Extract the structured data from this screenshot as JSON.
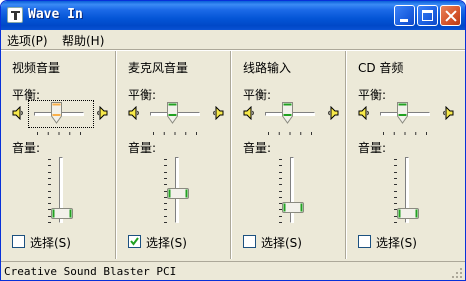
{
  "window": {
    "title": "Wave In"
  },
  "menu": [
    {
      "label": "选项(P)"
    },
    {
      "label": "帮助(H)"
    }
  ],
  "labels": {
    "balance": "平衡:",
    "volume": "音量:",
    "select": "选择(S)"
  },
  "channels": [
    {
      "name": "视频音量",
      "balance_level": 0.5,
      "volume_level": 0.12,
      "selected": false,
      "focused": true
    },
    {
      "name": "麦克风音量",
      "balance_level": 0.5,
      "volume_level": 0.45,
      "selected": true,
      "focused": false
    },
    {
      "name": "线路输入",
      "balance_level": 0.5,
      "volume_level": 0.22,
      "selected": false,
      "focused": false
    },
    {
      "name": "CD 音频",
      "balance_level": 0.5,
      "volume_level": 0.12,
      "selected": false,
      "focused": false
    }
  ],
  "status": {
    "text": "Creative Sound Blaster PCI"
  },
  "colors": {
    "title_bar": "#0455d6",
    "face": "#ece9d8",
    "thumb_green": "#21a121"
  }
}
